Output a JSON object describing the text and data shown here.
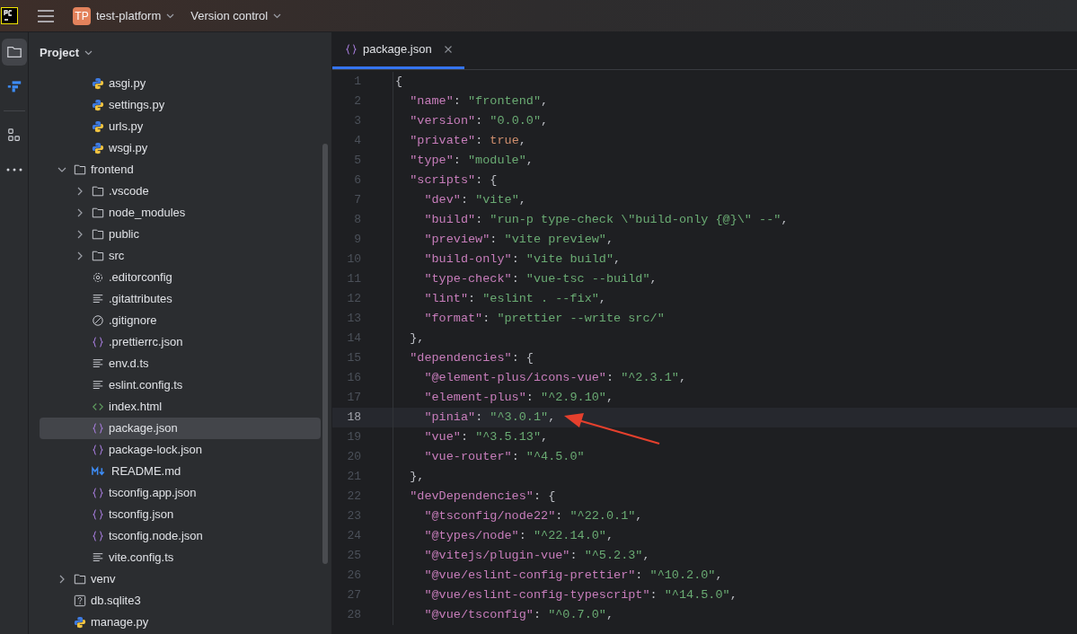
{
  "title_bar": {
    "project_badge": "TP",
    "project_name": "test-platform",
    "vcs_label": "Version control"
  },
  "tool_windows": [
    {
      "kind": "folder",
      "selected": true
    },
    {
      "kind": "structure",
      "selected": false
    },
    {
      "kind": "grid",
      "selected": false
    },
    {
      "kind": "more",
      "selected": false
    }
  ],
  "project_panel": {
    "title": "Project",
    "tree": {
      "continued_children": [
        {
          "label": "asgi.py",
          "kind": "python",
          "selected": false
        },
        {
          "label": "settings.py",
          "kind": "python",
          "selected": false
        },
        {
          "label": "urls.py",
          "kind": "python",
          "selected": false
        },
        {
          "label": "wsgi.py",
          "kind": "python",
          "selected": false
        }
      ],
      "items": [
        {
          "label": "frontend",
          "kind": "folder",
          "expanded": true,
          "selected": false,
          "children": [
            {
              "label": ".vscode",
              "kind": "folder",
              "expanded": false,
              "selected": false
            },
            {
              "label": "node_modules",
              "kind": "folder",
              "expanded": false,
              "selected": false
            },
            {
              "label": "public",
              "kind": "folder",
              "expanded": false,
              "selected": false
            },
            {
              "label": "src",
              "kind": "folder",
              "expanded": false,
              "selected": false
            },
            {
              "label": ".editorconfig",
              "kind": "config",
              "selected": false
            },
            {
              "label": ".gitattributes",
              "kind": "text",
              "selected": false
            },
            {
              "label": ".gitignore",
              "kind": "ignore",
              "selected": false
            },
            {
              "label": ".prettierrc.json",
              "kind": "json",
              "selected": false
            },
            {
              "label": "env.d.ts",
              "kind": "text",
              "selected": false
            },
            {
              "label": "eslint.config.ts",
              "kind": "text",
              "selected": false
            },
            {
              "label": "index.html",
              "kind": "html",
              "selected": false
            },
            {
              "label": "package.json",
              "kind": "json",
              "selected": true
            },
            {
              "label": "package-lock.json",
              "kind": "json",
              "selected": false
            },
            {
              "label": "README.md",
              "kind": "markdown",
              "selected": false
            },
            {
              "label": "tsconfig.app.json",
              "kind": "json",
              "selected": false
            },
            {
              "label": "tsconfig.json",
              "kind": "json",
              "selected": false
            },
            {
              "label": "tsconfig.node.json",
              "kind": "json",
              "selected": false
            },
            {
              "label": "vite.config.ts",
              "kind": "text",
              "selected": false
            }
          ]
        },
        {
          "label": "venv",
          "kind": "folder",
          "expanded": false,
          "selected": false
        },
        {
          "label": "db.sqlite3",
          "kind": "unknown",
          "selected": false
        },
        {
          "label": "manage.py",
          "kind": "python",
          "selected": false
        }
      ]
    }
  },
  "editor": {
    "tabs": [
      {
        "label": "package.json",
        "kind": "json",
        "selected": true
      }
    ],
    "lines": [
      {
        "number": "1",
        "text": "{",
        "current": false
      },
      {
        "number": "2",
        "text": "  \"name\": \"frontend\",",
        "current": false
      },
      {
        "number": "3",
        "text": "  \"version\": \"0.0.0\",",
        "current": false
      },
      {
        "number": "4",
        "text": "  \"private\": true,",
        "current": false
      },
      {
        "number": "5",
        "text": "  \"type\": \"module\",",
        "current": false
      },
      {
        "number": "6",
        "text": "  \"scripts\": {",
        "current": false
      },
      {
        "number": "7",
        "text": "    \"dev\": \"vite\",",
        "current": false
      },
      {
        "number": "8",
        "text": "    \"build\": \"run-p type-check \\\"build-only {@}\\\" --\",",
        "current": false
      },
      {
        "number": "9",
        "text": "    \"preview\": \"vite preview\",",
        "current": false
      },
      {
        "number": "10",
        "text": "    \"build-only\": \"vite build\",",
        "current": false
      },
      {
        "number": "11",
        "text": "    \"type-check\": \"vue-tsc --build\",",
        "current": false
      },
      {
        "number": "12",
        "text": "    \"lint\": \"eslint . --fix\",",
        "current": false
      },
      {
        "number": "13",
        "text": "    \"format\": \"prettier --write src/\"",
        "current": false
      },
      {
        "number": "14",
        "text": "  },",
        "current": false
      },
      {
        "number": "15",
        "text": "  \"dependencies\": {",
        "current": false
      },
      {
        "number": "16",
        "text": "    \"@element-plus/icons-vue\": \"^2.3.1\",",
        "current": false
      },
      {
        "number": "17",
        "text": "    \"element-plus\": \"^2.9.10\",",
        "current": false
      },
      {
        "number": "18",
        "text": "    \"pinia\": \"^3.0.1\",",
        "current": true
      },
      {
        "number": "19",
        "text": "    \"vue\": \"^3.5.13\",",
        "current": false
      },
      {
        "number": "20",
        "text": "    \"vue-router\": \"^4.5.0\"",
        "current": false
      },
      {
        "number": "21",
        "text": "  },",
        "current": false
      },
      {
        "number": "22",
        "text": "  \"devDependencies\": {",
        "current": false
      },
      {
        "number": "23",
        "text": "    \"@tsconfig/node22\": \"^22.0.1\",",
        "current": false
      },
      {
        "number": "24",
        "text": "    \"@types/node\": \"^22.14.0\",",
        "current": false
      },
      {
        "number": "25",
        "text": "    \"@vitejs/plugin-vue\": \"^5.2.3\",",
        "current": false
      },
      {
        "number": "26",
        "text": "    \"@vue/eslint-config-prettier\": \"^10.2.0\",",
        "current": false
      },
      {
        "number": "27",
        "text": "    \"@vue/eslint-config-typescript\": \"^14.5.0\",",
        "current": false
      },
      {
        "number": "28",
        "text": "    \"@vue/tsconfig\": \"^0.7.0\",",
        "current": false
      }
    ]
  }
}
